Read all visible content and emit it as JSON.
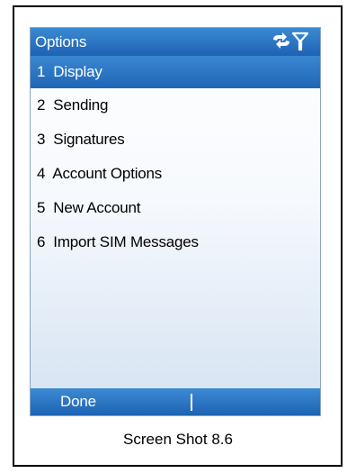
{
  "screen": {
    "title": "Options",
    "status_icons": [
      "data-sync-icon",
      "signal-antenna-icon"
    ],
    "menu_items": [
      {
        "label": "1  Display",
        "selected": true
      },
      {
        "label": "2  Sending",
        "selected": false
      },
      {
        "label": "3  Signatures",
        "selected": false
      },
      {
        "label": "4  Account Options",
        "selected": false
      },
      {
        "label": "5  New Account",
        "selected": false
      },
      {
        "label": "6  Import SIM Messages",
        "selected": false
      }
    ],
    "softkeys": {
      "left_label": "Done",
      "right_label": ""
    }
  },
  "caption": "Screen Shot 8.6",
  "colors": {
    "accent_blue": "#1f66b6",
    "highlight_blue_top": "#3a87d0",
    "text_on_accent": "#ffffff",
    "text": "#000000",
    "frame_border": "#000000"
  }
}
